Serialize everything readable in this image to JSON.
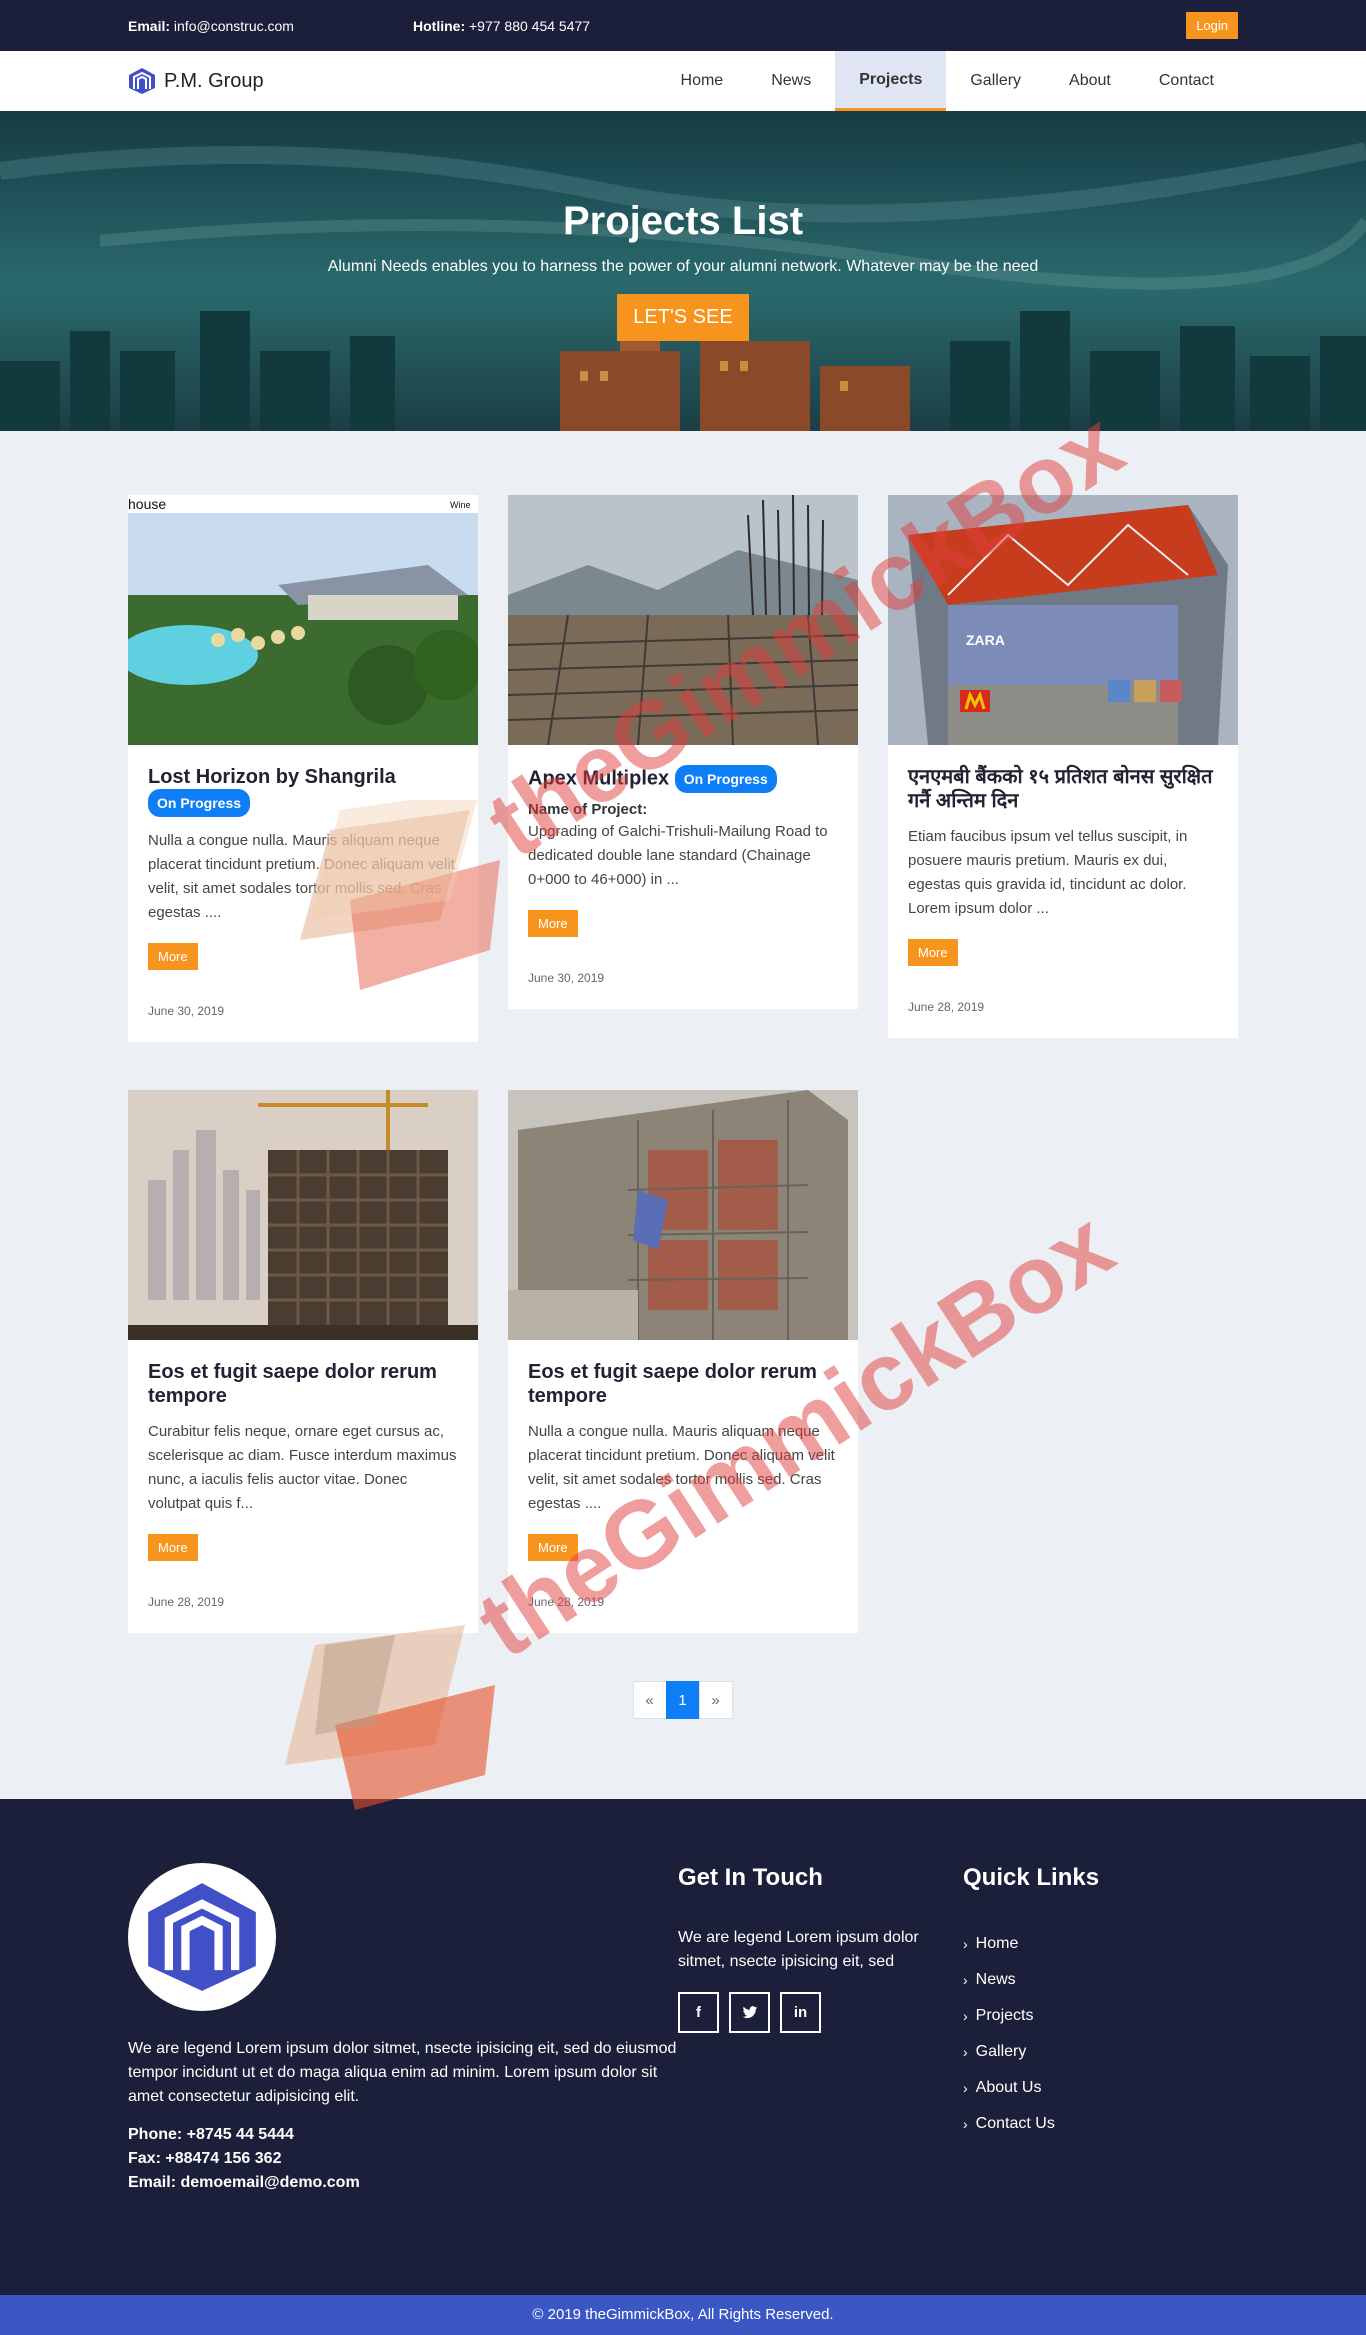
{
  "topbar": {
    "email_label": "Email:",
    "email_value": "info@construc.com",
    "hotline_label": "Hotline:",
    "hotline_value": "+977 880 454 5477",
    "login_label": "Login"
  },
  "nav": {
    "brand": "P.M. Group",
    "links": [
      "Home",
      "News",
      "Projects",
      "Gallery",
      "About",
      "Contact"
    ],
    "active": "Projects"
  },
  "hero": {
    "title": "Projects List",
    "subtitle": "Alumni Needs enables you to harness the power of your alumni network. Whatever may be the need",
    "cta": "LET'S SEE"
  },
  "projects": [
    {
      "title": "Lost Horizon by Shangrila",
      "badge": "On Progress",
      "text": "Nulla a congue nulla. Mauris aliquam neque placerat tincidunt pretium. Donec aliquam velit velit, sit amet sodales tortor mollis sed. Cras egestas ....",
      "more": "More",
      "date": "June 30, 2019",
      "image_labels": [
        "house",
        "Wine"
      ]
    },
    {
      "title": "Apex Multiplex",
      "badge": "On Progress",
      "name_label": "Name of Project:",
      "text": "Upgrading of Galchi-Trishuli-Mailung Road to dedicated double lane standard (Chainage 0+000 to 46+000) in ...",
      "more": "More",
      "date": "June 30, 2019"
    },
    {
      "title": "एनएमबी बैंकको १५ प्रतिशत बोनस सुरक्षित गर्नै अन्तिम दिन",
      "text": "Etiam faucibus ipsum vel tellus suscipit, in posuere mauris pretium. Mauris ex dui, egestas quis gravida id, tincidunt ac dolor. Lorem ipsum dolor ...",
      "more": "More",
      "date": "June 28, 2019",
      "image_labels": [
        "ZARA"
      ]
    },
    {
      "title": "Eos et fugit saepe dolor rerum tempore",
      "text": "Curabitur felis neque, ornare eget cursus ac, scelerisque ac diam. Fusce interdum maximus nunc, a iaculis felis auctor vitae. Donec volutpat quis f...",
      "more": "More",
      "date": "June 28, 2019"
    },
    {
      "title": "Eos et fugit saepe dolor rerum tempore",
      "text": "Nulla a congue nulla. Mauris aliquam neque placerat tincidunt pretium. Donec aliquam velit velit, sit amet sodales tortor mollis sed. Cras egestas ....",
      "more": "More",
      "date": "June 28, 2019"
    }
  ],
  "pagination": {
    "prev": "«",
    "current": "1",
    "next": "»"
  },
  "watermark": "theGimmickBox",
  "footer": {
    "about": "We are legend Lorem ipsum dolor sitmet, nsecte ipisicing eit, sed do eiusmod tempor incidunt ut et do maga aliqua enim ad minim. Lorem ipsum dolor sit amet consectetur adipisicing elit.",
    "phone": "Phone: +8745 44 5444",
    "fax": "Fax: +88474 156 362",
    "email": "Email: demoemail@demo.com",
    "touch_heading": "Get In Touch",
    "touch_text": "We are legend Lorem ipsum dolor sitmet, nsecte ipisicing eit, sed",
    "socials": [
      "facebook-icon",
      "twitter-icon",
      "linkedin-icon"
    ],
    "links_heading": "Quick Links",
    "links": [
      "Home",
      "News",
      "Projects",
      "Gallery",
      "About Us",
      "Contact Us"
    ]
  },
  "copyright": "© 2019 theGimmickBox, All Rights Reserved.",
  "colors": {
    "dark_navy": "#1b1f3a",
    "accent_orange": "#f7941d",
    "badge_blue": "#0d7ef5",
    "footer_bar": "#3a57c4",
    "logo_blue": "#4250c8"
  }
}
